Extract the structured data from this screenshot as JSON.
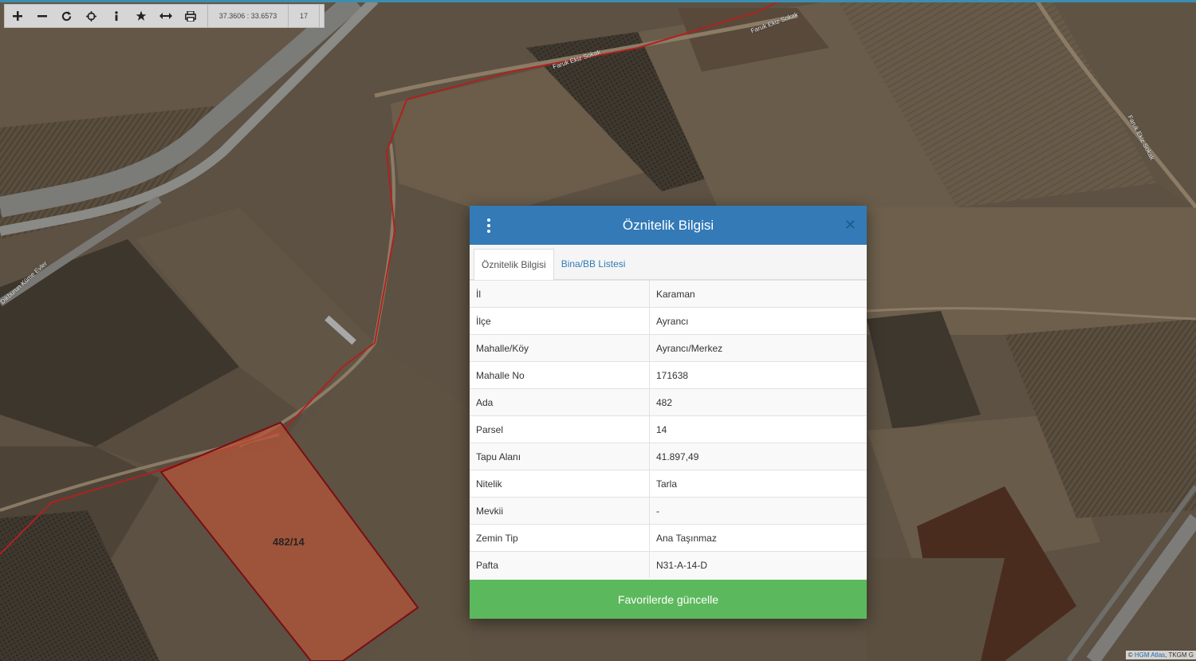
{
  "toolbar": {
    "buttons": [
      {
        "name": "zoom-in",
        "icon": "plus-icon"
      },
      {
        "name": "zoom-out",
        "icon": "minus-icon"
      },
      {
        "name": "refresh",
        "icon": "refresh-icon"
      },
      {
        "name": "locate",
        "icon": "crosshair-icon"
      },
      {
        "name": "info",
        "icon": "info-icon"
      },
      {
        "name": "favorites",
        "icon": "star-icon"
      },
      {
        "name": "measure",
        "icon": "arrows-horizontal-icon"
      },
      {
        "name": "print",
        "icon": "print-icon"
      }
    ],
    "coordinates": "37.3606 : 33.6573",
    "zoom_level": "17"
  },
  "map": {
    "parcel_label": "482/14",
    "road_labels": [
      "Faruk Ekiz Sokak",
      "Faruk Ekiz Sokak",
      "Faruk Ekiz Sokak",
      "Dikburun Küme Evler"
    ],
    "colors": {
      "parcel_fill": "#b4553a",
      "parcel_stroke": "#7a0e14",
      "boundary_line": "#b0211f"
    }
  },
  "attribution": {
    "prefix": "©",
    "link": "HGM Atlas",
    "suffix": ", TKGM G"
  },
  "modal": {
    "title": "Öznitelik Bilgisi",
    "tabs": [
      {
        "label": "Öznitelik Bilgisi",
        "active": true
      },
      {
        "label": "Bina/BB Listesi",
        "active": false
      }
    ],
    "rows": [
      {
        "key": "İl",
        "value": "Karaman"
      },
      {
        "key": "İlçe",
        "value": "Ayrancı"
      },
      {
        "key": "Mahalle/Köy",
        "value": "Ayrancı/Merkez"
      },
      {
        "key": "Mahalle No",
        "value": "171638"
      },
      {
        "key": "Ada",
        "value": "482"
      },
      {
        "key": "Parsel",
        "value": "14"
      },
      {
        "key": "Tapu Alanı",
        "value": "41.897,49"
      },
      {
        "key": "Nitelik",
        "value": "Tarla"
      },
      {
        "key": "Mevkii",
        "value": "-"
      },
      {
        "key": "Zemin Tip",
        "value": "Ana Taşınmaz"
      },
      {
        "key": "Pafta",
        "value": "N31-A-14-D"
      }
    ],
    "button_label": "Favorilerde güncelle",
    "colors": {
      "header": "#337ab7",
      "button": "#5cb85c"
    }
  }
}
